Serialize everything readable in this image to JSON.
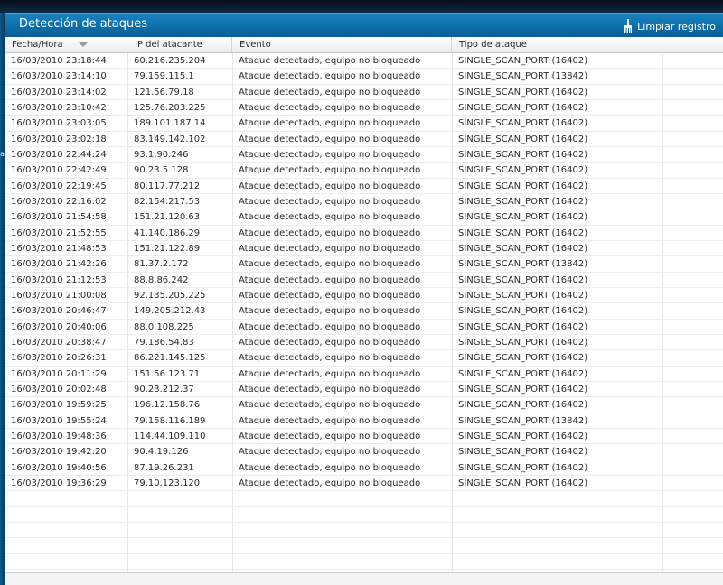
{
  "panel": {
    "title": "Detección de ataques",
    "clear_label": "Limpiar registro",
    "side_glyph": "a"
  },
  "columns": [
    "Fecha/Hora",
    "IP del atacante",
    "Evento",
    "Tipo de ataque"
  ],
  "rows": [
    [
      "16/03/2010 23:18:44",
      "60.216.235.204",
      "Ataque detectado, equipo no bloqueado",
      "SINGLE_SCAN_PORT (16402)"
    ],
    [
      "16/03/2010 23:14:10",
      "79.159.115.1",
      "Ataque detectado, equipo no bloqueado",
      "SINGLE_SCAN_PORT (13842)"
    ],
    [
      "16/03/2010 23:14:02",
      "121.56.79.18",
      "Ataque detectado, equipo no bloqueado",
      "SINGLE_SCAN_PORT (16402)"
    ],
    [
      "16/03/2010 23:10:42",
      "125.76.203.225",
      "Ataque detectado, equipo no bloqueado",
      "SINGLE_SCAN_PORT (16402)"
    ],
    [
      "16/03/2010 23:03:05",
      "189.101.187.14",
      "Ataque detectado, equipo no bloqueado",
      "SINGLE_SCAN_PORT (16402)"
    ],
    [
      "16/03/2010 23:02:18",
      "83.149.142.102",
      "Ataque detectado, equipo no bloqueado",
      "SINGLE_SCAN_PORT (16402)"
    ],
    [
      "16/03/2010 22:44:24",
      "93.1.90.246",
      "Ataque detectado, equipo no bloqueado",
      "SINGLE_SCAN_PORT (16402)"
    ],
    [
      "16/03/2010 22:42:49",
      "90.23.5.128",
      "Ataque detectado, equipo no bloqueado",
      "SINGLE_SCAN_PORT (16402)"
    ],
    [
      "16/03/2010 22:19:45",
      "80.117.77.212",
      "Ataque detectado, equipo no bloqueado",
      "SINGLE_SCAN_PORT (16402)"
    ],
    [
      "16/03/2010 22:16:02",
      "82.154.217.53",
      "Ataque detectado, equipo no bloqueado",
      "SINGLE_SCAN_PORT (16402)"
    ],
    [
      "16/03/2010 21:54:58",
      "151.21.120.63",
      "Ataque detectado, equipo no bloqueado",
      "SINGLE_SCAN_PORT (16402)"
    ],
    [
      "16/03/2010 21:52:55",
      "41.140.186.29",
      "Ataque detectado, equipo no bloqueado",
      "SINGLE_SCAN_PORT (16402)"
    ],
    [
      "16/03/2010 21:48:53",
      "151.21.122.89",
      "Ataque detectado, equipo no bloqueado",
      "SINGLE_SCAN_PORT (16402)"
    ],
    [
      "16/03/2010 21:42:26",
      "81.37.2.172",
      "Ataque detectado, equipo no bloqueado",
      "SINGLE_SCAN_PORT (13842)"
    ],
    [
      "16/03/2010 21:12:53",
      "88.8.86.242",
      "Ataque detectado, equipo no bloqueado",
      "SINGLE_SCAN_PORT (16402)"
    ],
    [
      "16/03/2010 21:00:08",
      "92.135.205.225",
      "Ataque detectado, equipo no bloqueado",
      "SINGLE_SCAN_PORT (16402)"
    ],
    [
      "16/03/2010 20:46:47",
      "149.205.212.43",
      "Ataque detectado, equipo no bloqueado",
      "SINGLE_SCAN_PORT (16402)"
    ],
    [
      "16/03/2010 20:40:06",
      "88.0.108.225",
      "Ataque detectado, equipo no bloqueado",
      "SINGLE_SCAN_PORT (16402)"
    ],
    [
      "16/03/2010 20:38:47",
      "79.186.54.83",
      "Ataque detectado, equipo no bloqueado",
      "SINGLE_SCAN_PORT (16402)"
    ],
    [
      "16/03/2010 20:26:31",
      "86.221.145.125",
      "Ataque detectado, equipo no bloqueado",
      "SINGLE_SCAN_PORT (16402)"
    ],
    [
      "16/03/2010 20:11:29",
      "151.56.123.71",
      "Ataque detectado, equipo no bloqueado",
      "SINGLE_SCAN_PORT (16402)"
    ],
    [
      "16/03/2010 20:02:48",
      "90.23.212.37",
      "Ataque detectado, equipo no bloqueado",
      "SINGLE_SCAN_PORT (16402)"
    ],
    [
      "16/03/2010 19:59:25",
      "196.12.158.76",
      "Ataque detectado, equipo no bloqueado",
      "SINGLE_SCAN_PORT (16402)"
    ],
    [
      "16/03/2010 19:55:24",
      "79.158.116.189",
      "Ataque detectado, equipo no bloqueado",
      "SINGLE_SCAN_PORT (13842)"
    ],
    [
      "16/03/2010 19:48:36",
      "114.44.109.110",
      "Ataque detectado, equipo no bloqueado",
      "SINGLE_SCAN_PORT (16402)"
    ],
    [
      "16/03/2010 19:42:20",
      "90.4.19.126",
      "Ataque detectado, equipo no bloqueado",
      "SINGLE_SCAN_PORT (16402)"
    ],
    [
      "16/03/2010 19:40:56",
      "87.19.26.231",
      "Ataque detectado, equipo no bloqueado",
      "SINGLE_SCAN_PORT (16402)"
    ],
    [
      "16/03/2010 19:36:29",
      "79.10.123.120",
      "Ataque detectado, equipo no bloqueado",
      "SINGLE_SCAN_PORT (16402)"
    ]
  ],
  "colors": {
    "titlebar": "#0e6ea9",
    "text": "#2a2a2a",
    "grid_line": "#e6e6e6"
  }
}
